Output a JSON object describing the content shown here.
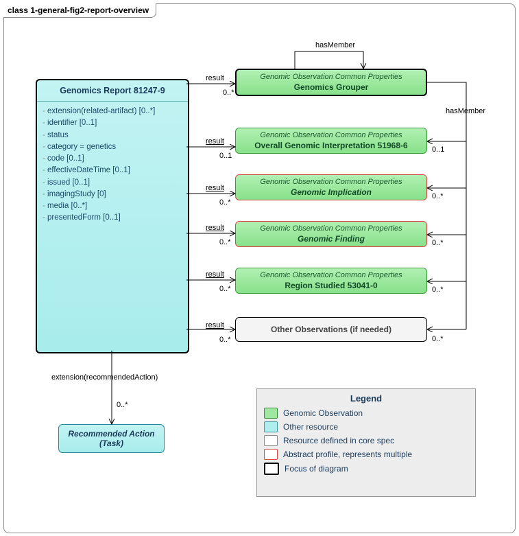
{
  "frame_title": "class 1-general-fig2-report-overview",
  "main_class": {
    "title": "Genomics Report 81247-9",
    "attrs": [
      "extension(related-artifact) [0..*]",
      "identifier [0..1]",
      "status",
      "category = genetics",
      "code [0..1]",
      "effectiveDateTime [0..1]",
      "issued [0..1]",
      "imagingStudy [0]",
      "media [0..*]",
      "presentedForm [0..1]"
    ]
  },
  "boxes": {
    "grouper": {
      "stereo": "Genomic Observation Common Properties",
      "name": "Genomics Grouper"
    },
    "interp": {
      "stereo": "Genomic Observation Common Properties",
      "name": "Overall Genomic Interpretation 51968-6"
    },
    "impl": {
      "stereo": "Genomic Observation Common Properties",
      "name": "Genomic Implication"
    },
    "finding": {
      "stereo": "Genomic Observation Common Properties",
      "name": "Genomic Finding"
    },
    "region": {
      "stereo": "Genomic Observation Common Properties",
      "name": "Region Studied 53041-0"
    },
    "other": {
      "name": "Other Observations (if needed)"
    },
    "rec": {
      "name": "Recommended Action (Task)"
    }
  },
  "edges": {
    "result": "result",
    "hasMember": "hasMember",
    "extRec": "extension(recommendedAction)",
    "c0s": "0..*",
    "c01": "0..1"
  },
  "legend": {
    "title": "Legend",
    "items": [
      "Genomic Observation",
      "Other resource",
      "Resource defined in core spec",
      "Abstract profile, represents multiple",
      "Focus of diagram"
    ]
  }
}
